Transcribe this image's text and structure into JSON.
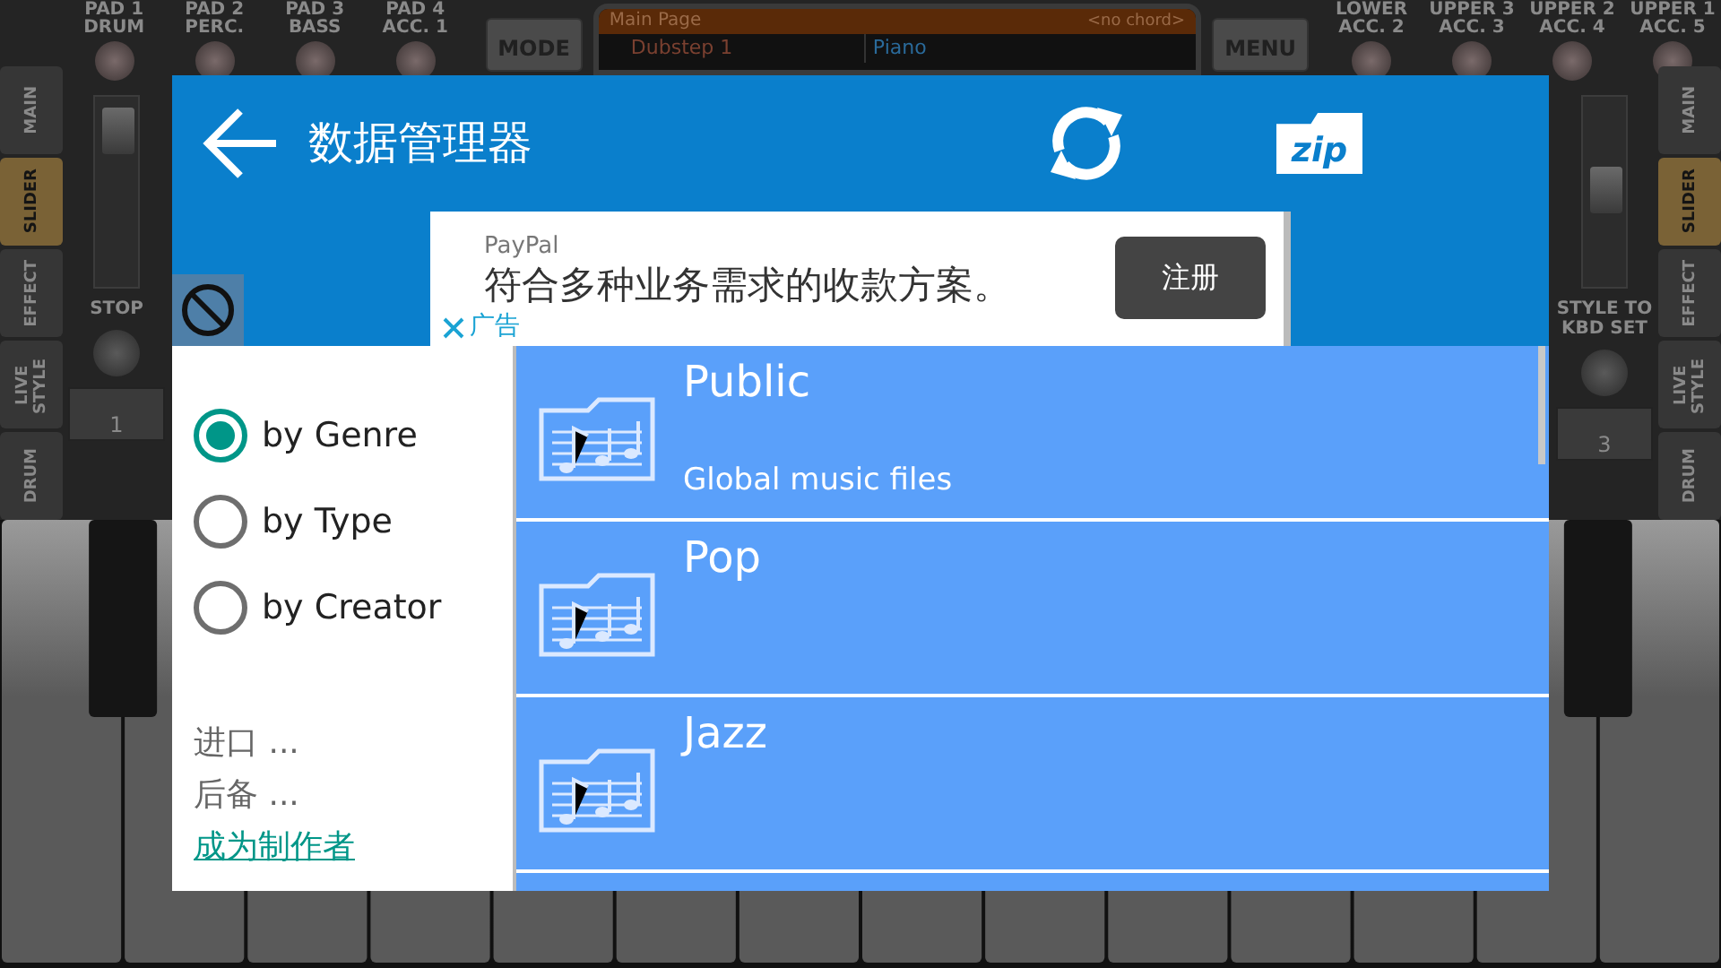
{
  "background_app": {
    "pads_left": [
      {
        "lines": [
          "PAD 1",
          "DRUM"
        ]
      },
      {
        "lines": [
          "PAD 2",
          "PERC."
        ]
      },
      {
        "lines": [
          "PAD 3",
          "BASS"
        ]
      },
      {
        "lines": [
          "PAD 4",
          "ACC. 1"
        ]
      }
    ],
    "mode_button": "MODE",
    "display": {
      "title": "Main Page",
      "chord": "<no chord>",
      "style": "Dubstep 1",
      "voice": "Piano"
    },
    "menu_button": "MENU",
    "pads_right": [
      {
        "lines": [
          "LOWER",
          "ACC. 2"
        ]
      },
      {
        "lines": [
          "UPPER 3",
          "ACC. 3"
        ]
      },
      {
        "lines": [
          "UPPER 2",
          "ACC. 4"
        ]
      },
      {
        "lines": [
          "UPPER 1",
          "ACC. 5"
        ]
      }
    ],
    "left_tabs": [
      {
        "label": "MAIN",
        "selected": false
      },
      {
        "label": "SLIDER",
        "selected": true
      },
      {
        "label": "EFFECT",
        "selected": false
      },
      {
        "label": "LIVE STYLE",
        "selected": false
      },
      {
        "label": "DRUM",
        "selected": false
      }
    ],
    "right_tabs": [
      {
        "label": "MAIN",
        "selected": false
      },
      {
        "label": "SLIDER",
        "selected": true
      },
      {
        "label": "EFFECT",
        "selected": false
      },
      {
        "label": "LIVE STYLE",
        "selected": false
      },
      {
        "label": "DRUM",
        "selected": false
      }
    ],
    "left_controls": {
      "slider": {
        "level": 0.9
      },
      "knob_label": "STOP",
      "button": "1"
    },
    "right_controls": {
      "slider": {
        "level": 0.5
      },
      "knob_label": "STYLE TO KBD SET",
      "button": "3"
    }
  },
  "dialog": {
    "title": "数据管理器",
    "ad": {
      "brand": "PayPal",
      "text": "符合多种业务需求的收款方案。",
      "button": "注册",
      "tag": "广告"
    },
    "filters": [
      {
        "label": "by Genre",
        "selected": true
      },
      {
        "label": "by Type",
        "selected": false
      },
      {
        "label": "by Creator",
        "selected": false
      }
    ],
    "links": [
      {
        "text": "进口 ...",
        "kind": "plain"
      },
      {
        "text": "后备 ...",
        "kind": "plain"
      },
      {
        "text": "成为制作者",
        "kind": "link"
      }
    ],
    "folders": [
      {
        "title": "Public",
        "subtitle": "Global music files"
      },
      {
        "title": "Pop"
      },
      {
        "title": "Jazz"
      }
    ],
    "zip_label": "zip"
  }
}
